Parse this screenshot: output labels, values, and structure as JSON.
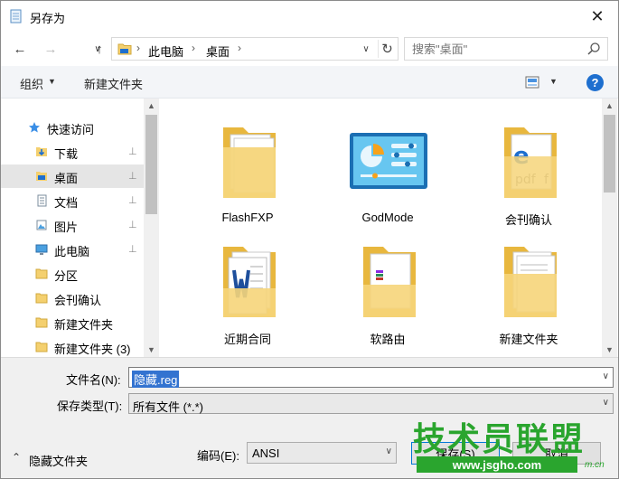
{
  "window": {
    "title": "另存为",
    "close_glyph": "✕"
  },
  "nav": {
    "back_glyph": "←",
    "forward_glyph": "→",
    "recent_glyph": "∨",
    "up_glyph": "↑",
    "address_segments": [
      "此电脑",
      "桌面"
    ],
    "address_sep": "›",
    "dropdown_glyph": "∨",
    "refresh_glyph": "↻",
    "search_placeholder": "搜索\"桌面\""
  },
  "toolbar": {
    "organize_label": "组织",
    "new_folder_label": "新建文件夹",
    "help_label": "?"
  },
  "sidebar": {
    "quick_access_label": "快速访问",
    "items": [
      {
        "label": "下载",
        "pinned": true,
        "icon": "download-folder-icon"
      },
      {
        "label": "桌面",
        "pinned": true,
        "icon": "desktop-folder-icon",
        "selected": true
      },
      {
        "label": "文档",
        "pinned": true,
        "icon": "documents-icon"
      },
      {
        "label": "图片",
        "pinned": true,
        "icon": "pictures-icon"
      },
      {
        "label": "此电脑",
        "pinned": true,
        "icon": "computer-icon"
      },
      {
        "label": "分区",
        "pinned": false,
        "icon": "folder-icon"
      },
      {
        "label": "会刊确认",
        "pinned": false,
        "icon": "folder-icon"
      },
      {
        "label": "新建文件夹",
        "pinned": false,
        "icon": "folder-icon"
      },
      {
        "label": "新建文件夹 (3)",
        "pinned": false,
        "icon": "folder-icon"
      }
    ],
    "pin_glyph": "📌"
  },
  "files": [
    {
      "label": "FlashFXP",
      "icon": "folder-docs-icon"
    },
    {
      "label": "GodMode",
      "icon": "control-panel-icon"
    },
    {
      "label": "会刊确认",
      "icon": "folder-pdf-icon"
    },
    {
      "label": "近期合同",
      "icon": "folder-word-icon"
    },
    {
      "label": "软路由",
      "icon": "folder-winrar-icon"
    },
    {
      "label": "新建文件夹",
      "icon": "folder-docs-icon"
    }
  ],
  "form": {
    "filename_label": "文件名(N):",
    "filename_value": "隐藏.reg",
    "filetype_label": "保存类型(T):",
    "filetype_value": "所有文件  (*.*)",
    "hide_folders_label": "隐藏文件夹",
    "encoding_label": "编码(E):",
    "encoding_value": "ANSI",
    "save_label": "保存(S)",
    "cancel_label": "取消"
  },
  "watermark": {
    "title": "技术员联盟",
    "url": "www.jsgho.com",
    "small": "m.cn"
  },
  "colors": {
    "accent": "#0078d7",
    "selection": "#3373d0",
    "help": "#1e6fcf",
    "folder": "#f4d06f",
    "watermark": "#2aa52e"
  }
}
